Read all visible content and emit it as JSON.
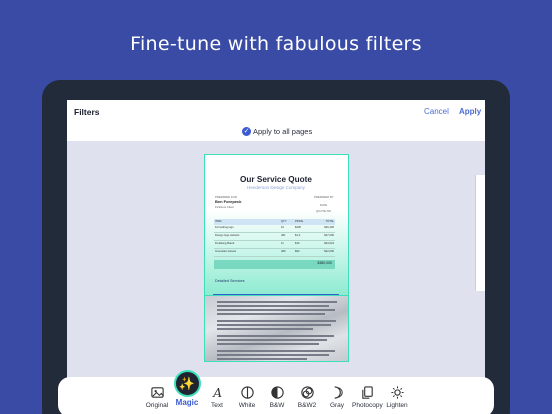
{
  "headline": "Fine-tune with fabulous filters",
  "topbar": {
    "title": "Filters",
    "cancel": "Cancel",
    "apply": "Apply"
  },
  "apply_all": {
    "label": "Apply to all pages",
    "checked": true
  },
  "document": {
    "title": "Our Service Quote",
    "subtitle": "Henderson Design Company",
    "prepared_for_label": "PREPARED FOR",
    "client_name": "Ben Forepeck",
    "client_sub": "Fictitious Client",
    "prepared_by_label": "PREPARED BY",
    "date_label": "DATE",
    "quote_no_label": "QUOTE NO.",
    "table_headers": [
      "ITEM",
      "QTY",
      "PRICE",
      "TOTAL"
    ],
    "table_rows": [
      [
        "Formatting logo",
        "10",
        "$490",
        "$46,400"
      ],
      [
        "Design logo variants",
        "481",
        "$1,0",
        "$47,000"
      ],
      [
        "Finalising Brand",
        "11",
        "$16",
        "$43,024"
      ],
      [
        "Innovation Assets",
        "480",
        "$90",
        "$42,000"
      ]
    ],
    "total": "$380,000",
    "detailed_label": "Detailed Services"
  },
  "filters": [
    {
      "name": "Original",
      "icon": "image-icon",
      "active": false
    },
    {
      "name": "Magic",
      "icon": "magic-wand-icon",
      "active": true
    },
    {
      "name": "Text",
      "icon": "text-icon",
      "active": false
    },
    {
      "name": "White",
      "icon": "white-icon",
      "active": false
    },
    {
      "name": "B&W",
      "icon": "bw-icon",
      "active": false
    },
    {
      "name": "B&W2",
      "icon": "bw2-icon",
      "active": false
    },
    {
      "name": "Gray",
      "icon": "gray-icon",
      "active": false
    },
    {
      "name": "Photocopy",
      "icon": "photocopy-icon",
      "active": false
    },
    {
      "name": "Lighten",
      "icon": "lighten-icon",
      "active": false
    }
  ],
  "colors": {
    "background": "#3a4ba6",
    "accent": "#4a6cd4",
    "highlight": "#3ddfb9"
  }
}
